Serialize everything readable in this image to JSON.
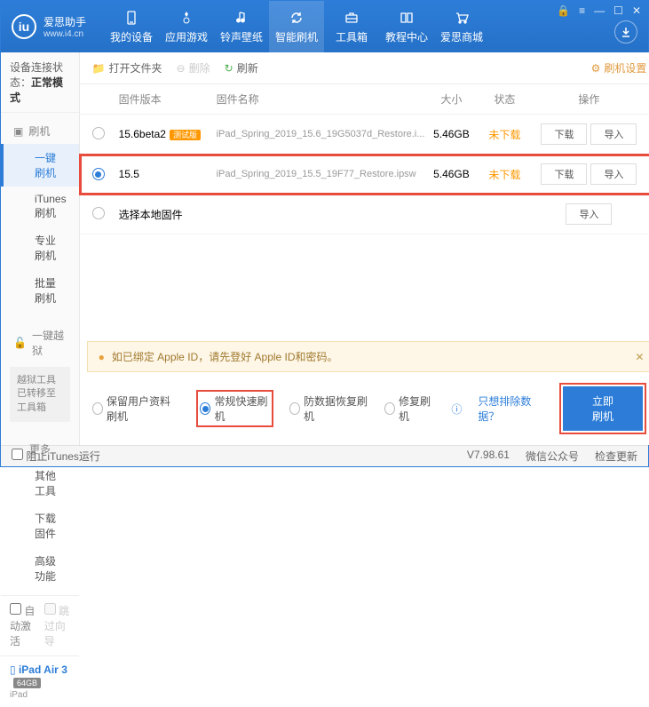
{
  "header": {
    "logo_title": "爱思助手",
    "logo_sub": "www.i4.cn",
    "tabs": [
      "我的设备",
      "应用游戏",
      "铃声壁纸",
      "智能刷机",
      "工具箱",
      "教程中心",
      "爱思商城"
    ]
  },
  "sidebar": {
    "conn_label": "设备连接状态：",
    "conn_value": "正常模式",
    "group_flash": "刷机",
    "items_flash": [
      "一键刷机",
      "iTunes刷机",
      "专业刷机",
      "批量刷机"
    ],
    "group_jb": "一键越狱",
    "jb_note": "越狱工具已转移至工具箱",
    "group_more": "更多",
    "items_more": [
      "其他工具",
      "下载固件",
      "高级功能"
    ],
    "auto_activate": "自动激活",
    "skip_guide": "跳过向导",
    "device_name": "iPad Air 3",
    "device_storage": "64GB",
    "device_type": "iPad"
  },
  "toolbar": {
    "open_folder": "打开文件夹",
    "delete": "删除",
    "refresh": "刷新",
    "settings": "刷机设置"
  },
  "table": {
    "h_version": "固件版本",
    "h_name": "固件名称",
    "h_size": "大小",
    "h_status": "状态",
    "h_ops": "操作",
    "rows": [
      {
        "ver": "15.6beta2",
        "beta": "测试版",
        "name": "iPad_Spring_2019_15.6_19G5037d_Restore.i...",
        "size": "5.46GB",
        "status": "未下载"
      },
      {
        "ver": "15.5",
        "beta": "",
        "name": "iPad_Spring_2019_15.5_19F77_Restore.ipsw",
        "size": "5.46GB",
        "status": "未下载"
      }
    ],
    "local_fw": "选择本地固件",
    "btn_download": "下载",
    "btn_import": "导入"
  },
  "warning": "如已绑定 Apple ID，请先登好 Apple ID和密码。",
  "flash": {
    "opt_keep": "保留用户资料刷机",
    "opt_normal": "常规快速刷机",
    "opt_recovery": "防数据恢复刷机",
    "opt_repair": "修复刷机",
    "link_exclude": "只想排除数据？",
    "btn_flash": "立即刷机"
  },
  "footer": {
    "block_itunes": "阻止iTunes运行",
    "version": "V7.98.61",
    "wechat": "微信公众号",
    "update": "检查更新"
  }
}
